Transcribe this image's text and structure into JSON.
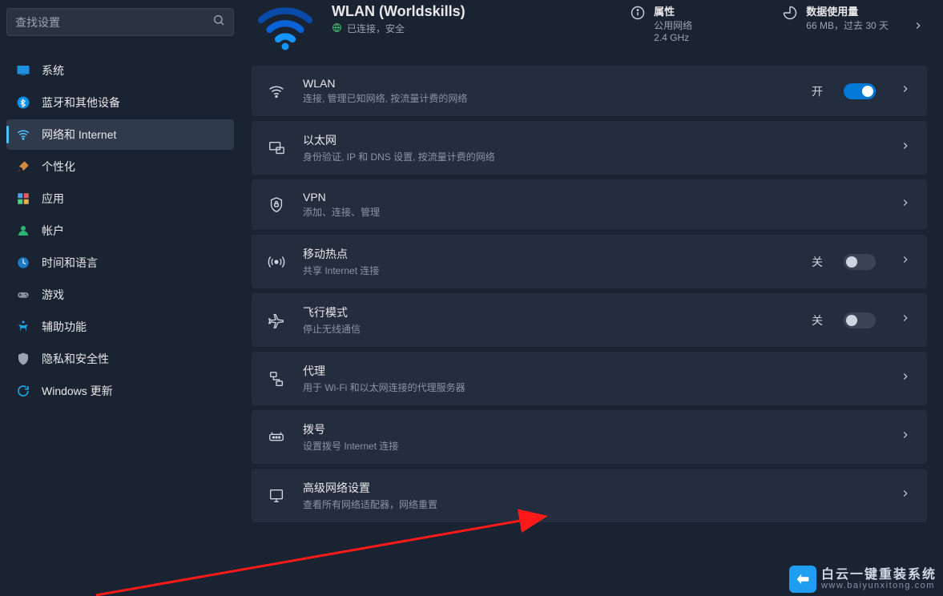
{
  "search": {
    "placeholder": "查找设置"
  },
  "nav": {
    "system": "系统",
    "bluetooth": "蓝牙和其他设备",
    "network": "网络和 Internet",
    "personalize": "个性化",
    "apps": "应用",
    "accounts": "帐户",
    "time": "时间和语言",
    "gaming": "游戏",
    "accessibility": "辅助功能",
    "privacy": "隐私和安全性",
    "update": "Windows 更新"
  },
  "header": {
    "title": "WLAN (Worldskills)",
    "status": "已连接，安全",
    "props": {
      "label": "属性",
      "line1": "公用网络",
      "line2": "2.4 GHz"
    },
    "usage": {
      "label": "数据使用量",
      "line1": "66 MB，过去 30 天"
    }
  },
  "cards": {
    "wlan": {
      "title": "WLAN",
      "sub": "连接, 管理已知网络, 按流量计费的网络",
      "state_label": "开",
      "on": true
    },
    "ethernet": {
      "title": "以太网",
      "sub": "身份验证, IP 和 DNS 设置, 按流量计费的网络"
    },
    "vpn": {
      "title": "VPN",
      "sub": "添加、连接、管理"
    },
    "hotspot": {
      "title": "移动热点",
      "sub": "共享 Internet 连接",
      "state_label": "关",
      "on": false
    },
    "airplane": {
      "title": "飞行模式",
      "sub": "停止无线通信",
      "state_label": "关",
      "on": false
    },
    "proxy": {
      "title": "代理",
      "sub": "用于 Wi-Fi 和以太网连接的代理服务器"
    },
    "dialup": {
      "title": "拨号",
      "sub": "设置拨号 Internet 连接"
    },
    "advanced": {
      "title": "高级网络设置",
      "sub": "查看所有网络适配器，网络重置"
    }
  },
  "watermark": {
    "line1": "白云一键重装系统",
    "line2": "www.baiyunxitong.com"
  }
}
